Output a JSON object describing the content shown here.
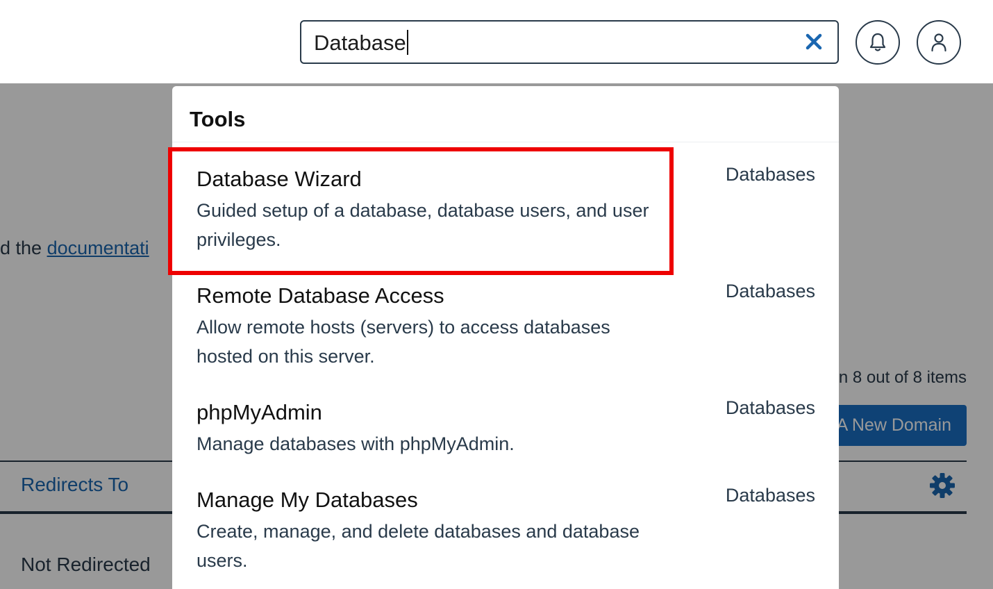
{
  "search": {
    "value": "Database",
    "clear_icon": "close-icon"
  },
  "header_icons": {
    "notifications": "bell-icon",
    "account": "user-icon"
  },
  "background": {
    "doc_text_prefix": "d the ",
    "doc_link": "documentati",
    "items_count": "n 8 out of 8 items",
    "new_domain_button": "A New Domain",
    "column_redirects": "Redirects To",
    "row_redirect_value": "Not Redirected",
    "settings_icon": "gear-icon"
  },
  "dropdown": {
    "section_title": "Tools",
    "results": [
      {
        "title": "Database Wizard",
        "description": "Guided setup of a database, database users, and user privileges.",
        "category": "Databases"
      },
      {
        "title": "Remote Database Access",
        "description": "Allow remote hosts (servers) to access databases hosted on this server.",
        "category": "Databases"
      },
      {
        "title": "phpMyAdmin",
        "description": "Manage databases with phpMyAdmin.",
        "category": "Databases"
      },
      {
        "title": "Manage My Databases",
        "description": "Create, manage, and delete databases and database users.",
        "category": "Databases"
      }
    ]
  },
  "colors": {
    "highlight": "#ee0000",
    "primary": "#1a6fc4",
    "text": "#293a4a"
  }
}
